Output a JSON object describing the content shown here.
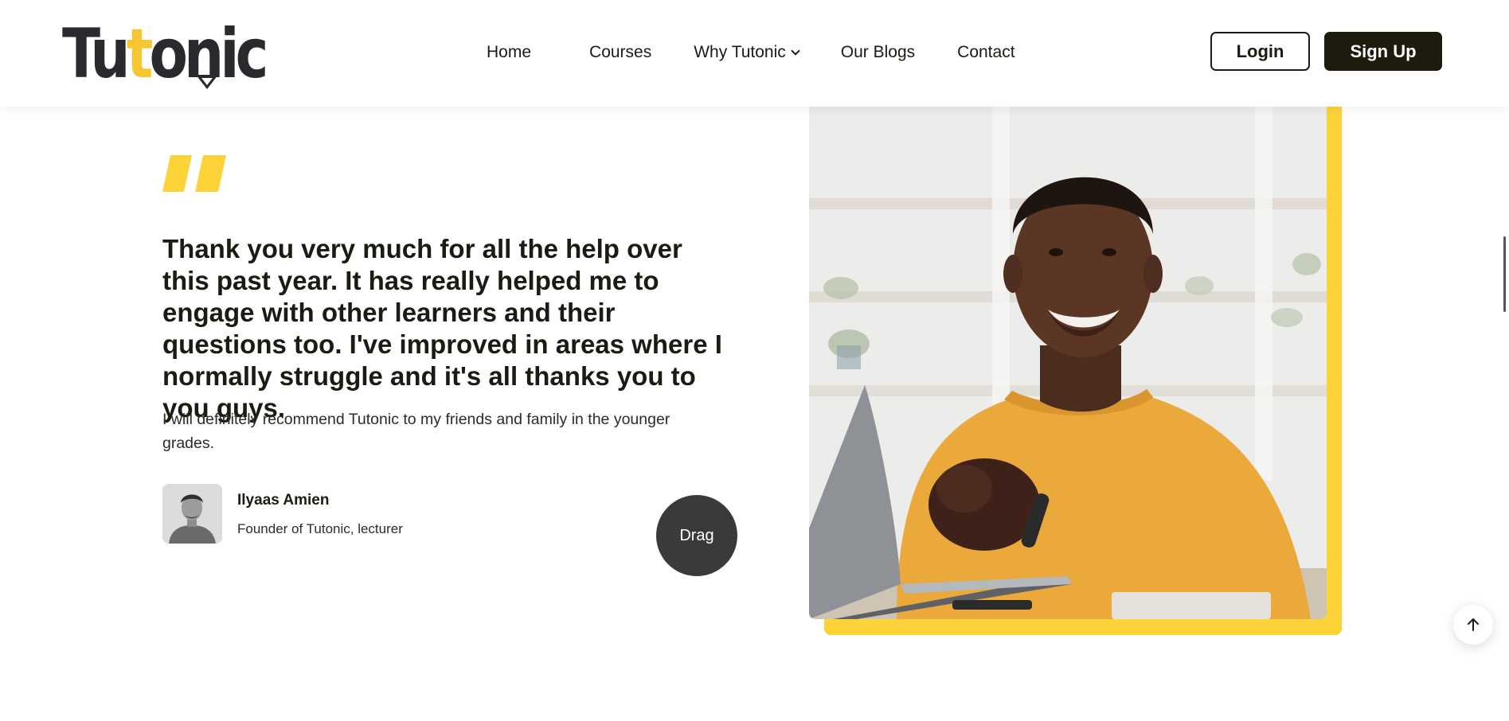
{
  "brand": {
    "logo_text_pre": "Tu",
    "logo_text_t": "t",
    "logo_text_post": "onic",
    "accent": "#fdd33a",
    "dark": "#1c1b0d"
  },
  "nav": {
    "items": [
      "Home",
      "Courses",
      "Why Tutonic",
      "Our Blogs",
      "Contact"
    ]
  },
  "auth": {
    "login": "Login",
    "signup": "Sign Up"
  },
  "testimonial": {
    "quote": "Thank you very much for all the help over this past year. It has really helped me to engage with other learners and their questions too. I've improved in areas where I normally struggle and it's all thanks you to you guys.",
    "subquote": "I will definitely recommend Tutonic to my friends and family in the younger grades.",
    "author_name": "Ilyaas Amien",
    "author_role": "Founder of Tutonic, lecturer",
    "drag_label": "Drag"
  },
  "icons": {
    "quote": "quote-icon",
    "dropdown": "chevron-down-icon",
    "back_to_top": "arrow-up-icon"
  }
}
